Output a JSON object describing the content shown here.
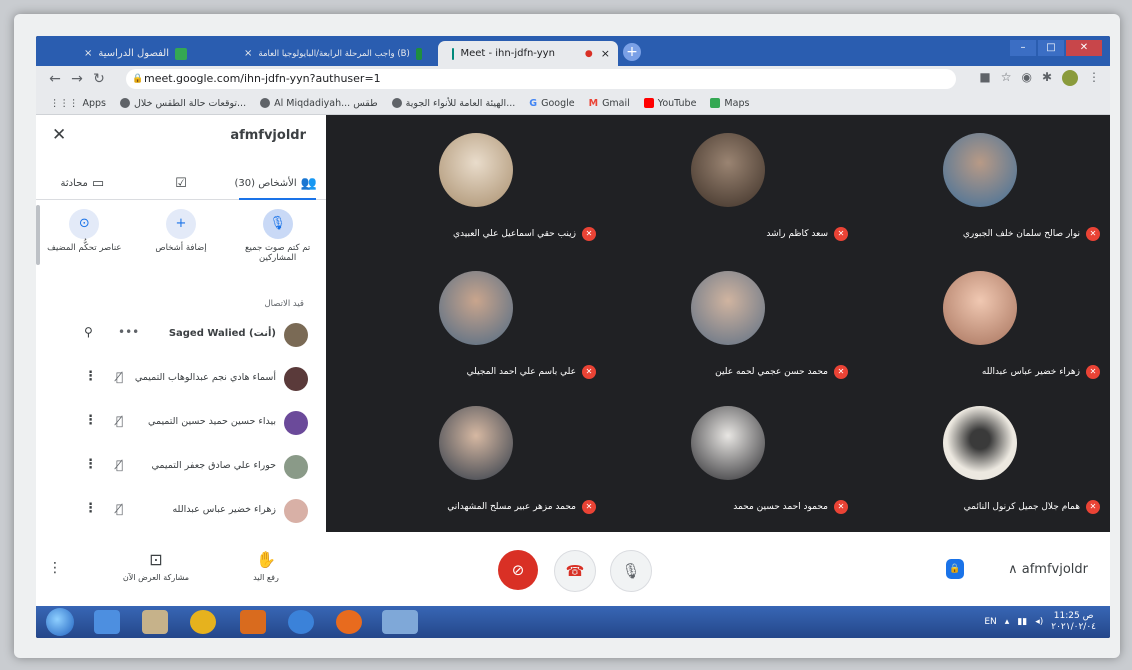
{
  "browser": {
    "tabs": [
      {
        "label": "الفصول الدراسية",
        "favicon_color": "#34a853",
        "active": false
      },
      {
        "label": "واجب المرحلة الرابعة/البايولوجيا العامة (B)",
        "favicon_color": "#1e8e3e",
        "active": false
      },
      {
        "label": "Meet - ihn-jdfn-yyn",
        "favicon_color": "#00897b",
        "active": true
      }
    ],
    "close_glyph": "×",
    "new_tab_glyph": "+",
    "url": "meet.google.com/ihn-jdfn-yyn?authuser=1",
    "bookmarks": [
      {
        "label": "Apps",
        "color": "#5f6368"
      },
      {
        "label": "توقعات حالة الطقس خلال...",
        "color": "#5f6368"
      },
      {
        "label": "Al Miqdadiyah... طقس",
        "color": "#5f6368"
      },
      {
        "label": "الهيئة العامة للأنواء الجوية...",
        "color": "#5f6368"
      },
      {
        "label": "Google",
        "color": "#4285f4"
      },
      {
        "label": "Gmail",
        "color": "#ea4335"
      },
      {
        "label": "YouTube",
        "color": "#ff0000"
      },
      {
        "label": "Maps",
        "color": "#34a853"
      }
    ]
  },
  "panel": {
    "title": "afmfvjoldr",
    "tabs": [
      {
        "label": "محادثة",
        "icon": "chat-icon"
      },
      {
        "label": "",
        "icon": "activities-icon"
      },
      {
        "label": "الأشخاص (30)",
        "icon": "people-icon"
      }
    ],
    "actions": [
      {
        "label": "عناصر تحكُّم المضيف",
        "icon": "host-controls-icon",
        "glyph": "⊙"
      },
      {
        "label": "إضافة أشخاص",
        "icon": "add-person-icon",
        "glyph": "+"
      },
      {
        "label": "تم كتم صوت جميع المشاركين",
        "icon": "mute-all-icon",
        "glyph": "🎙"
      }
    ],
    "contributors_label": "قيد الاتصال",
    "participants": [
      {
        "name": "Saged Walied (أنت)",
        "avatar_color": "#7a6a55"
      },
      {
        "name": "أسماء هادي نجم عبدالوهاب التميمي",
        "avatar_color": "#5a3a3a"
      },
      {
        "name": "بيداء حسين حميد حسين التميمي",
        "avatar_color": "#6b4a9a"
      },
      {
        "name": "حوراء علي صادق جعفر التميمي",
        "avatar_color": "#8a9a88"
      },
      {
        "name": "زهراء خضير عباس عبدالله",
        "avatar_color": "#d8b0a6"
      }
    ]
  },
  "grid": {
    "tiles": [
      {
        "name": "زينب حقي اسماعيل علي العبيدي",
        "color": "#c9b79a"
      },
      {
        "name": "سعد كاظم راشد",
        "color": "#6f5b4d"
      },
      {
        "name": "نوار صالح سلمان خلف الجبوري",
        "color": "#587a9c"
      },
      {
        "name": "علي باسم علي احمد المجيلي",
        "color": "#6b7f93"
      },
      {
        "name": "محمد حسن عجمي لحمه علين",
        "color": "#7a8a9c"
      },
      {
        "name": "زهراء خضير عباس عبدالله",
        "color": "#d4a48f"
      },
      {
        "name": "محمد مزهر عبير مسلح المشهداني",
        "color": "#8c99a8"
      },
      {
        "name": "محمود احمد حسين محمد",
        "color": "#c9ccd0"
      },
      {
        "name": "همام جلال جميل كرنول النائمي",
        "color": "#d9d4cc"
      }
    ]
  },
  "bottom": {
    "present_label": "مشاركة العرض الآن",
    "raise_hand_label": "رفع اليد",
    "meeting_code": "afmfvjoldr"
  },
  "taskbar": {
    "lang": "EN",
    "time": "11:25 ص",
    "date": "٢٠٢١/٠٢/٠٤"
  }
}
